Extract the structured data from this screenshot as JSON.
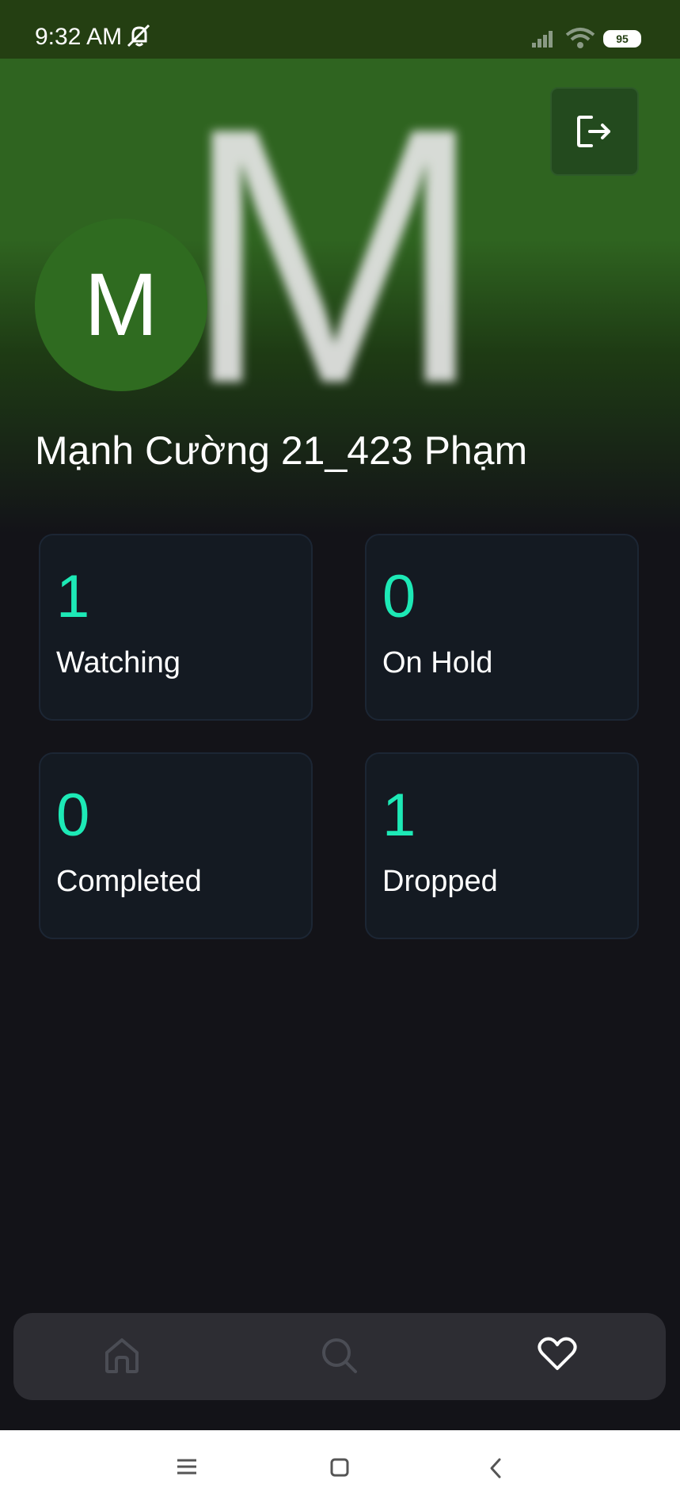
{
  "status_bar": {
    "time": "9:32 AM",
    "battery": "95",
    "icons": [
      "bell-muted-icon",
      "signal-icon",
      "wifi-icon",
      "battery-icon"
    ]
  },
  "profile": {
    "avatar_letter": "M",
    "name": "Mạnh Cường 21_423 Phạm"
  },
  "header": {
    "logout_icon": "logout-icon"
  },
  "stats": [
    {
      "count": "1",
      "label": "Watching"
    },
    {
      "count": "0",
      "label": "On Hold"
    },
    {
      "count": "0",
      "label": "Completed"
    },
    {
      "count": "1",
      "label": "Dropped"
    }
  ],
  "bottom_nav": {
    "items": [
      {
        "icon": "home-icon",
        "active": false
      },
      {
        "icon": "search-icon",
        "active": false
      },
      {
        "icon": "heart-icon",
        "active": true
      }
    ]
  },
  "system_nav": {
    "items": [
      "menu-icon",
      "home-square-icon",
      "back-icon"
    ]
  },
  "colors": {
    "accent": "#1de9b6",
    "hero_green": "#2f6420",
    "background": "#131318",
    "card": "#141a22"
  }
}
